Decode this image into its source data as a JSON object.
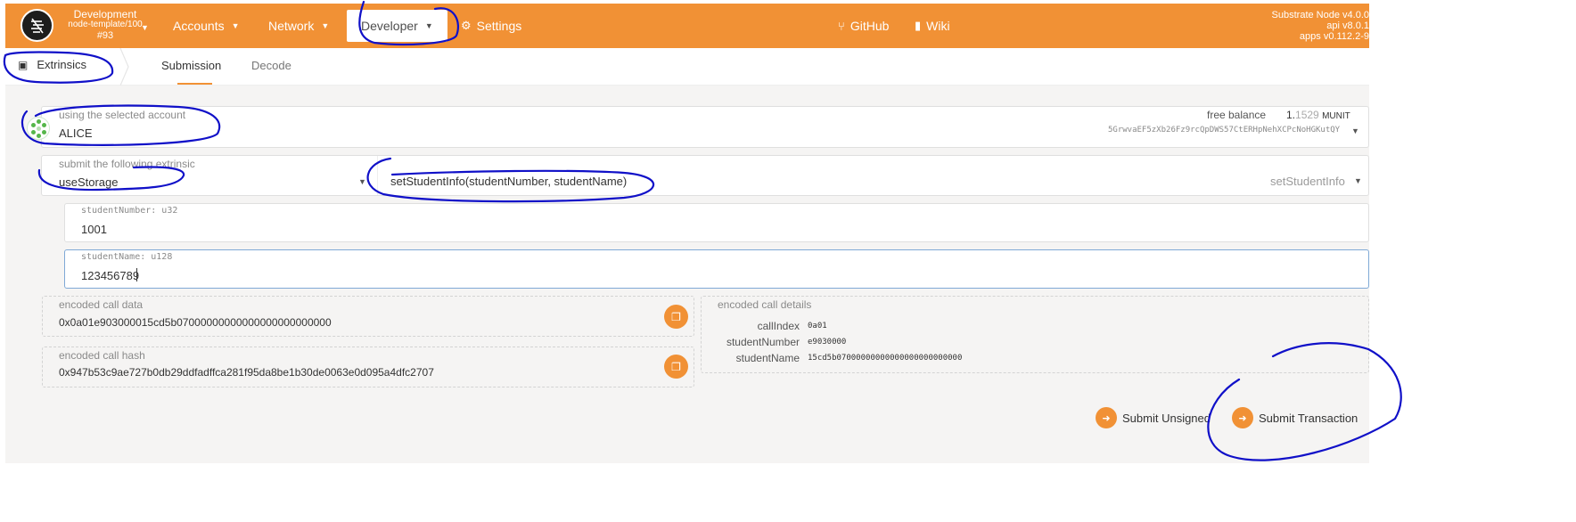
{
  "header": {
    "chain_name": "Development",
    "chain_version": "node-template/100",
    "block": "#93",
    "nav": [
      {
        "label": "Accounts"
      },
      {
        "label": "Network"
      },
      {
        "label": "Developer"
      },
      {
        "label": "Settings"
      }
    ],
    "links": [
      {
        "label": "GitHub"
      },
      {
        "label": "Wiki"
      }
    ],
    "version": {
      "node": "Substrate Node v4.0.0",
      "api": "api v8.0.1",
      "apps": "apps v0.112.2-9"
    }
  },
  "subnav": {
    "section": "Extrinsics",
    "tabs": [
      {
        "label": "Submission"
      },
      {
        "label": "Decode"
      }
    ]
  },
  "account": {
    "label": "using the selected account",
    "name": "ALICE",
    "balance_label": "free balance",
    "balance_int": "1.",
    "balance_frac": "1529",
    "balance_unit": "MUNIT",
    "address": "5GrwvaEF5zXb26Fz9rcQpDWS57CtERHpNehXCPcNoHGKutQY"
  },
  "extrinsic": {
    "label": "submit the following extrinsic",
    "pallet": "useStorage",
    "call": "setStudentInfo(studentNumber, studentName)",
    "call_hint": "setStudentInfo"
  },
  "params": [
    {
      "label": "studentNumber: u32",
      "value": "1001"
    },
    {
      "label": "studentName: u128",
      "value": "123456789"
    }
  ],
  "encoded": {
    "call_data_label": "encoded call data",
    "call_data": "0x0a01e903000015cd5b07000000000000000000000000",
    "call_hash_label": "encoded call hash",
    "call_hash": "0x947b53c9ae727b0db29ddfadffca281f95da8be1b30de0063e0d095a4dfc2707",
    "details_label": "encoded call details",
    "details": [
      {
        "key": "callIndex",
        "value": "0a01"
      },
      {
        "key": "studentNumber",
        "value": "e9030000"
      },
      {
        "key": "studentName",
        "value": "15cd5b07000000000000000000000000"
      }
    ]
  },
  "actions": {
    "unsigned": "Submit Unsigned",
    "transaction": "Submit Transaction"
  },
  "colors": {
    "accent": "#f19135",
    "annotation": "#1010c8"
  }
}
